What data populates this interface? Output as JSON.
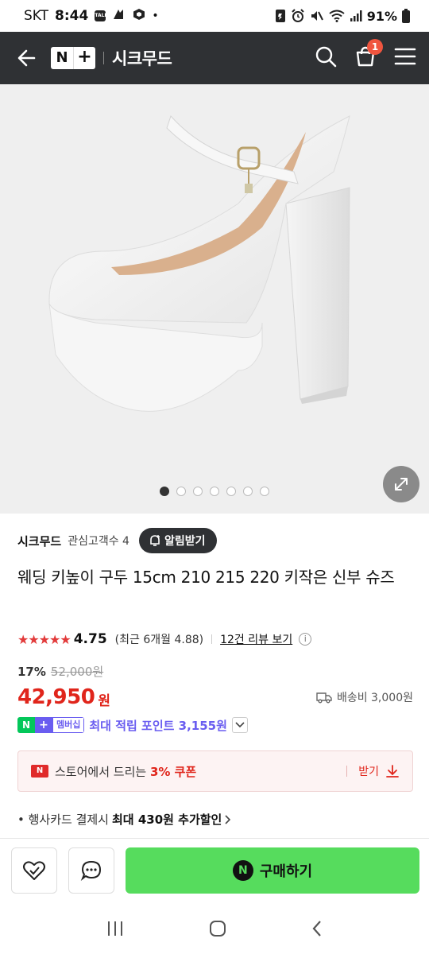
{
  "status_bar": {
    "carrier": "SKT",
    "time": "8:44",
    "talk_label": "TALK",
    "battery": "91%"
  },
  "header": {
    "logo_n": "N",
    "logo_plus": "+",
    "store_name": "시크무드",
    "cart_count": "1"
  },
  "gallery": {
    "page_count": 7,
    "current_index": 1
  },
  "store": {
    "seller_name": "시크무드",
    "followers": "관심고객수 4",
    "alarm_label": "알림받기"
  },
  "product": {
    "title": "웨딩 키높이 구두 15cm 210 215 220 키작은 신부 슈즈",
    "stars": "★★★★★",
    "rating": "4.75",
    "recent_rating": "(최근 6개월 4.88)",
    "review_link": "12건 리뷰 보기",
    "discount": "17%",
    "original_price": "52,000원",
    "price": "42,950",
    "currency": "원",
    "shipping": "배송비 3,000원"
  },
  "membership": {
    "badge_n": "N",
    "badge_plus": "+",
    "badge_label": "멤버십",
    "points": "최대 적립 포인트 3,155원"
  },
  "coupon": {
    "text_prefix": "스토어에서 드리는 ",
    "text_bold": "3% 쿠폰",
    "action_label": "받기"
  },
  "card_offer": {
    "prefix": "• 행사카드 결제시 ",
    "bold": "최대 430원 추가할인"
  },
  "actions": {
    "buy_label": "구매하기",
    "buy_icon_label": "N"
  },
  "colors": {
    "header_bg": "#2f3134",
    "price_red": "#e0251b",
    "membership_purple": "#6a5df0",
    "buy_green": "#56dc5d"
  }
}
